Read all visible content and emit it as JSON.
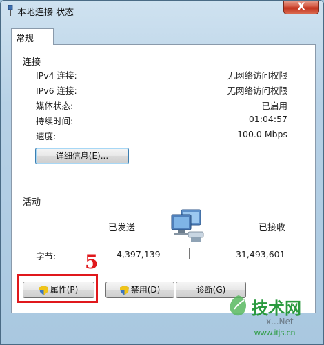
{
  "window": {
    "title": "本地连接 状态",
    "close_glyph": "X"
  },
  "tabs": [
    {
      "label": "常规"
    }
  ],
  "connection": {
    "group_title": "连接",
    "rows": [
      {
        "label": "IPv4 连接:",
        "value": "无网络访问权限"
      },
      {
        "label": "IPv6 连接:",
        "value": "无网络访问权限"
      },
      {
        "label": "媒体状态:",
        "value": "已启用"
      },
      {
        "label": "持续时间:",
        "value": "01:04:57"
      },
      {
        "label": "速度:",
        "value": "100.0 Mbps"
      }
    ],
    "details_button": "详细信息(E)..."
  },
  "activity": {
    "group_title": "活动",
    "sent_label": "已发送",
    "received_label": "已接收",
    "bytes_label": "字节:",
    "bytes_sent": "4,397,139",
    "bytes_received": "31,493,601",
    "network_icon": "network-computers-icon"
  },
  "buttons": {
    "properties": "属性(P)",
    "disable": "禁用(D)",
    "diagnose": "诊断(G)"
  },
  "annotation": {
    "step_number": "5",
    "color": "#e0181c"
  },
  "watermark": {
    "logo_text": "技术网",
    "sub_text": "x...Net",
    "url": "www.itjs.cn"
  }
}
